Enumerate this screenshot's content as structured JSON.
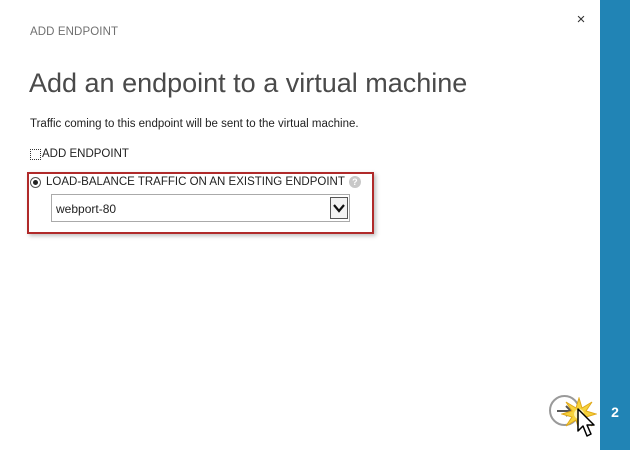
{
  "dialog": {
    "header_small": "ADD ENDPOINT",
    "title": "Add an endpoint to a virtual machine",
    "description": "Traffic coming to this endpoint will be sent to the virtual machine.",
    "close_icon": "close-icon",
    "close_glyph": "×"
  },
  "options": {
    "add_endpoint": {
      "label": "ADD ENDPOINT",
      "selected": false
    },
    "load_balance": {
      "label": "LOAD-BALANCE TRAFFIC ON AN EXISTING ENDPOINT",
      "selected": true,
      "help_glyph": "?"
    }
  },
  "endpoint_select": {
    "value": "webport-80"
  },
  "wizard": {
    "step": "2"
  },
  "colors": {
    "sidebar": "#2184b5",
    "highlight_border": "#b02a2a",
    "title": "#4a4a4a"
  },
  "icons": [
    "close-icon",
    "help-icon",
    "chevron-down-icon",
    "arrow-right-icon",
    "mouse-cursor-icon",
    "click-burst-icon"
  ]
}
